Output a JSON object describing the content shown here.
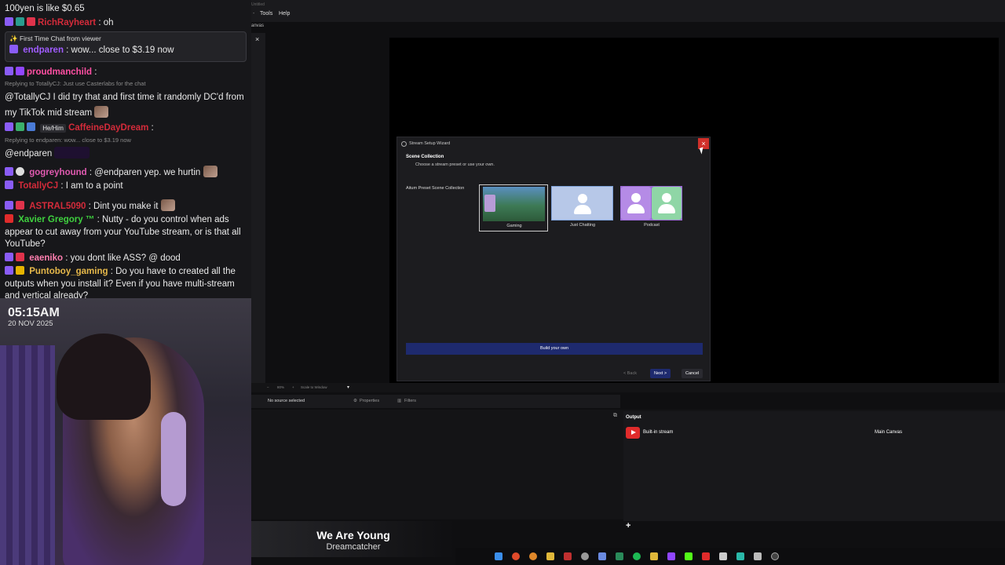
{
  "chat": {
    "top_line": "100yen is like $0.65",
    "m1": {
      "user": "RichRayheart",
      "text": ": oh"
    },
    "ftc": {
      "header": "✨ First Time Chat from viewer",
      "user": "endparen",
      "text": ": wow... close to $3.19 now"
    },
    "m2": {
      "user": "proudmanchild",
      "sep": ":",
      "reply": "Replying to TotallyCJ: Just use Casterlabs for the chat",
      "text": "@TotallyCJ I did try that and first time it randomly DC'd from my TikTok mid stream"
    },
    "m3": {
      "pronoun": "He/Him",
      "user": "CaffeineDayDream",
      "sep": ":",
      "reply": "Replying to endparen: wow... close to $3.19 now",
      "text": "@endparen"
    },
    "m4": {
      "user": "gogreyhound",
      "text": ": @endparen yep. we hurtin"
    },
    "m5": {
      "user": "TotallyCJ",
      "text": ": I am to a point"
    },
    "m6": {
      "user": "ASTRAL5090",
      "text": ": Dint you make it"
    },
    "m7": {
      "user": "Xavier Gregory ™",
      "text": ": Nutty - do you control when ads appear to cut away from your YouTube stream, or is that all YouTube?"
    },
    "m8": {
      "user": "eaeniko",
      "text": ": you dont like ASS? @ dood"
    },
    "m9": {
      "user": "Puntoboy_gaming",
      "text": ": Do you have to created all the outputs when you install it? Even if you have multi-stream and vertical already?"
    }
  },
  "cam": {
    "time": "05:15AM",
    "date": "20 NOV 2025"
  },
  "now_playing": {
    "title": "We Are Young",
    "artist": "Dreamcatcher"
  },
  "app": {
    "untitled": "Untitled",
    "menu_tools": "Tools",
    "menu_help": "Help",
    "tab": "anvas",
    "close_x": "×",
    "zoom": "80%",
    "scale": "Scale to Window",
    "no_source": "No source selected",
    "properties": "Properties",
    "filters": "Filters",
    "add": "+",
    "output_header": "Output",
    "output_item": "Built-in stream",
    "output_canvas": "Main Canvas"
  },
  "wizard": {
    "title": "Stream Setup Wizard",
    "close": "×",
    "heading": "Scene Collection",
    "subtitle": "Choose a stream preset or use your own.",
    "label": "Aitum Preset Scene Collection",
    "presets": [
      "Gaming",
      "Just Chatting",
      "Podcast"
    ],
    "build": "Build your own",
    "back": "< Back",
    "next": "Next >",
    "cancel": "Cancel"
  },
  "colors": {
    "accent": "#1e2a6e",
    "close_red": "#d0302a",
    "youtube": "#e02b2b"
  }
}
